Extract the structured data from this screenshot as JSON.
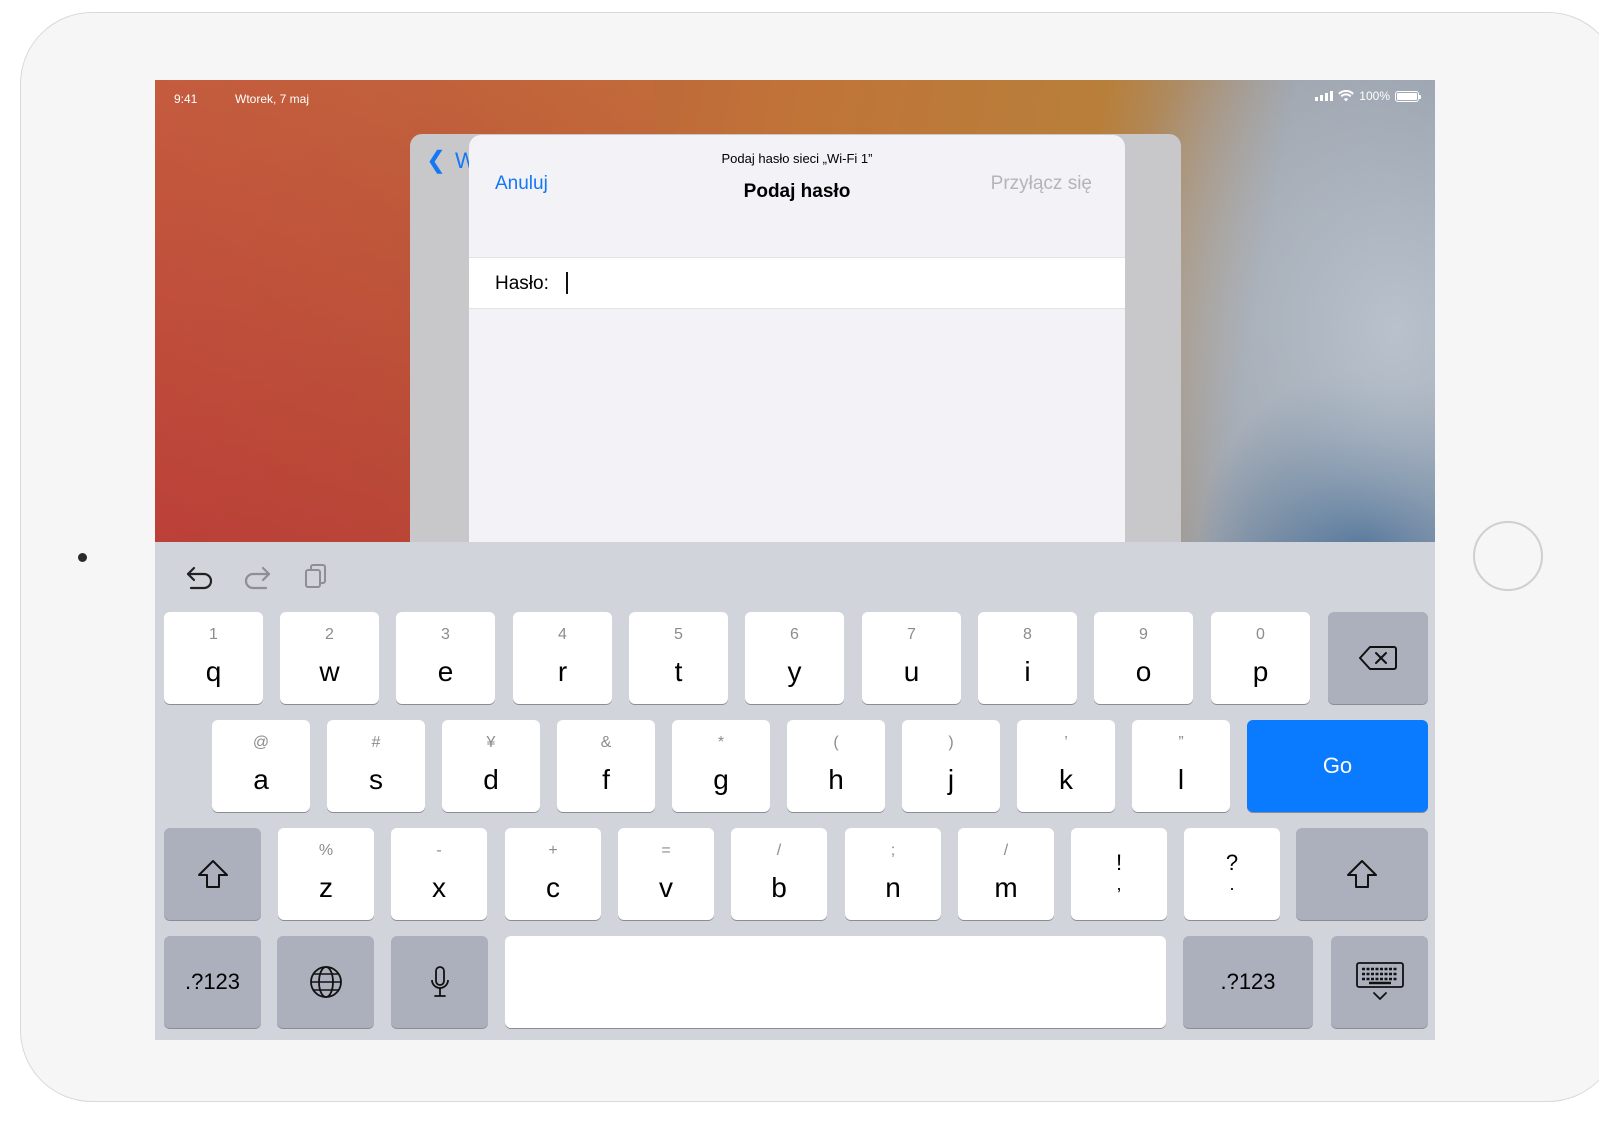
{
  "status_bar": {
    "time": "9:41",
    "date": "Wtorek, 7 maj",
    "battery": "100%"
  },
  "background_sheet": {
    "back_label": "W"
  },
  "dialog": {
    "prompt": "Podaj hasło sieci „Wi-Fi 1”",
    "title": "Podaj hasło",
    "cancel_label": "Anuluj",
    "join_label": "Przyłącz się",
    "password_label": "Hasło:"
  },
  "keyboard": {
    "toolbar": [
      "undo-icon",
      "redo-icon",
      "paste-icon"
    ],
    "row1": [
      {
        "hint": "1",
        "key": "q"
      },
      {
        "hint": "2",
        "key": "w"
      },
      {
        "hint": "3",
        "key": "e"
      },
      {
        "hint": "4",
        "key": "r"
      },
      {
        "hint": "5",
        "key": "t"
      },
      {
        "hint": "6",
        "key": "y"
      },
      {
        "hint": "7",
        "key": "u"
      },
      {
        "hint": "8",
        "key": "i"
      },
      {
        "hint": "9",
        "key": "o"
      },
      {
        "hint": "0",
        "key": "p"
      }
    ],
    "row2": [
      {
        "hint": "@",
        "key": "a"
      },
      {
        "hint": "#",
        "key": "s"
      },
      {
        "hint": "¥",
        "key": "d"
      },
      {
        "hint": "&",
        "key": "f"
      },
      {
        "hint": "*",
        "key": "g"
      },
      {
        "hint": "(",
        "key": "h"
      },
      {
        "hint": ")",
        "key": "j"
      },
      {
        "hint": "’",
        "key": "k"
      },
      {
        "hint": "”",
        "key": "l"
      }
    ],
    "row3": [
      {
        "hint": "%",
        "key": "z"
      },
      {
        "hint": "-",
        "key": "x"
      },
      {
        "hint": "+",
        "key": "c"
      },
      {
        "hint": "=",
        "key": "v"
      },
      {
        "hint": "/",
        "key": "b"
      },
      {
        "hint": ";",
        "key": "n"
      },
      {
        "hint": "/",
        "key": "m"
      },
      {
        "hint": "!",
        "key": ","
      },
      {
        "hint": "?",
        "key": "."
      }
    ],
    "go_label": "Go",
    "numbers_label": ".?123",
    "numbers_label_right": ".?123",
    "icons": {
      "delete": "delete-icon",
      "shift": "shift-icon",
      "globe": "globe-icon",
      "mic": "microphone-icon",
      "dismiss": "keyboard-dismiss-icon"
    }
  }
}
